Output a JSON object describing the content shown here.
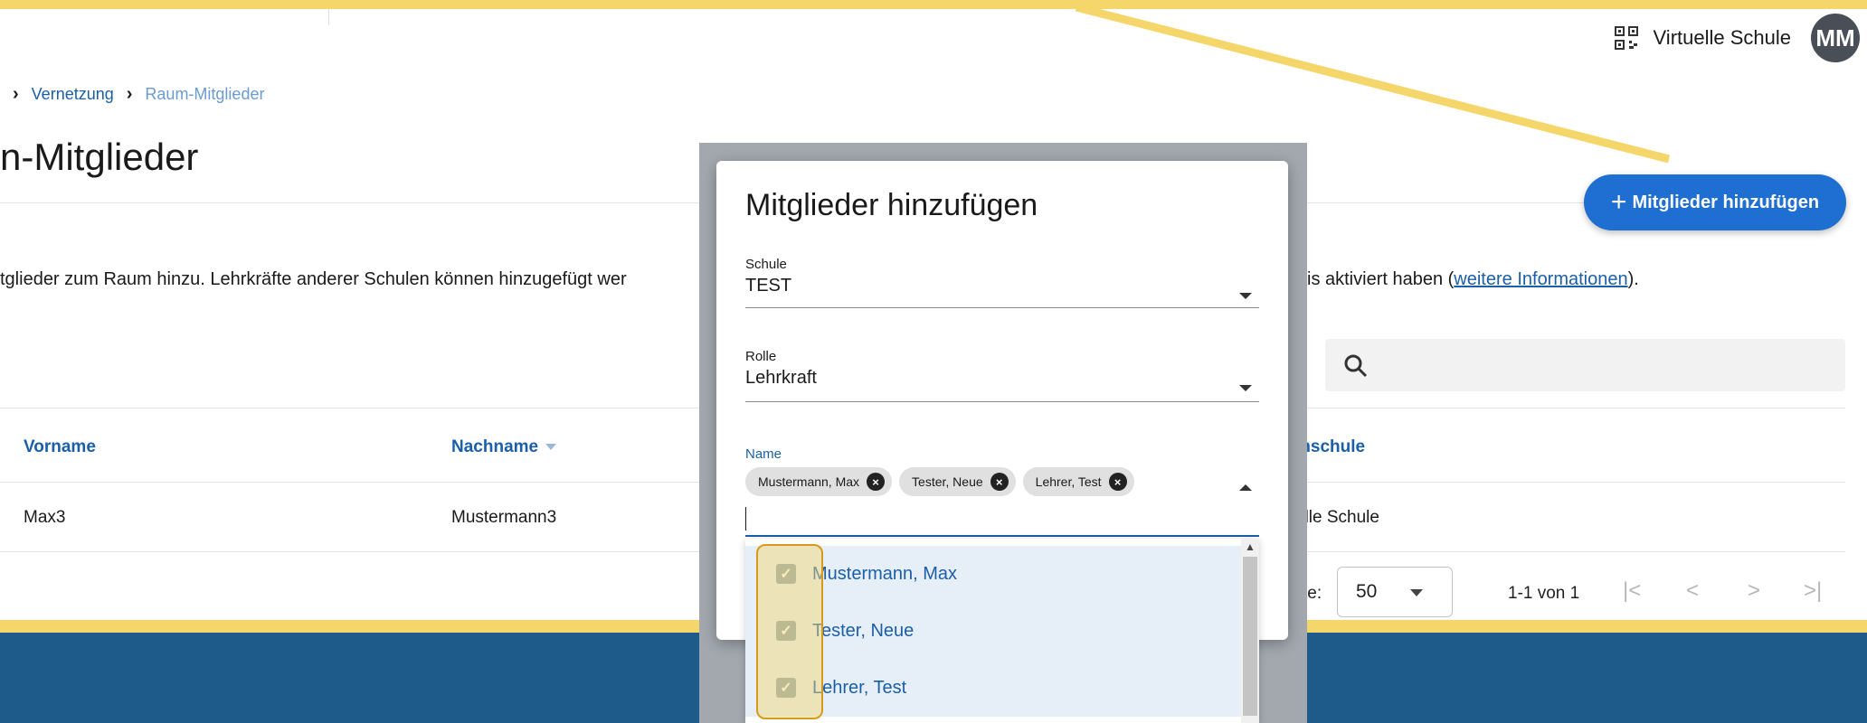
{
  "header": {
    "school_name": "Virtuelle Schule",
    "avatar_initials": "MM",
    "qr_icon": "qr-code-icon"
  },
  "breadcrumb": {
    "items": [
      "Vernetzung",
      "Raum-Mitglieder"
    ]
  },
  "page": {
    "title_visible": "n-Mitglieder",
    "add_button_label": "Mitglieder hinzufügen",
    "info_text_left": "tglieder zum Raum hinzu. Lehrkräfte anderer Schulen können hinzugefügt wer",
    "info_text_right_prefix": "is aktiviert haben (",
    "info_link": "weitere Informationen",
    "info_text_right_suffix": ")."
  },
  "table": {
    "columns": [
      "Vorname",
      "Nachname",
      "mschule"
    ],
    "rows": [
      {
        "vorname": "Max3",
        "nachname": "Mustermann3",
        "stammschule": "elle Schule"
      }
    ],
    "sorted_column": "Nachname"
  },
  "pagination": {
    "per_page_label": "te:",
    "per_page_value": "50",
    "range_text": "1-1 von 1",
    "first": "|<",
    "prev": "<",
    "next": ">",
    "last": ">|"
  },
  "dialog": {
    "title": "Mitglieder hinzufügen",
    "school_label": "Schule",
    "school_value": "TEST",
    "role_label": "Rolle",
    "role_value": "Lehrkraft",
    "name_label": "Name",
    "selected_chips": [
      "Mustermann, Max",
      "Tester, Neue",
      "Lehrer, Test"
    ],
    "options": [
      {
        "label": "Mustermann, Max",
        "checked": true
      },
      {
        "label": "Tester, Neue",
        "checked": true
      },
      {
        "label": "Lehrer, Test",
        "checked": true
      }
    ]
  },
  "colors": {
    "accent": "#1e6fd1",
    "brand_yellow": "#f5d66b",
    "footer_blue": "#1e5a8a"
  }
}
